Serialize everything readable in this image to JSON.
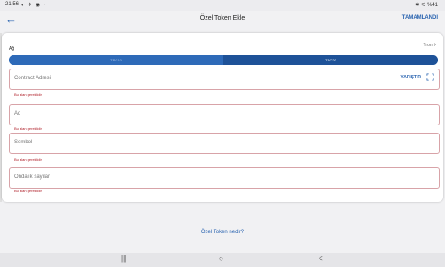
{
  "status": {
    "time": "21:56",
    "left_icons": "◐ ✈ ◉ ·",
    "right": "✱ ⚟ %41"
  },
  "header": {
    "title": "Özel Token Ekle",
    "done": "TAMAMLANDI"
  },
  "network": {
    "label": "Ağ",
    "value": "Tron",
    "tabs": [
      {
        "label": "TRC10"
      },
      {
        "label": "TRC20"
      }
    ]
  },
  "fields": [
    {
      "placeholder": "Contract Adresi",
      "paste": "YAPIŞTIR",
      "error": "Bu alan gereklidir"
    },
    {
      "placeholder": "Ad",
      "error": "Bu alan gereklidir"
    },
    {
      "placeholder": "Sembol",
      "error": "Bu alan gereklidir"
    },
    {
      "placeholder": "Ondalık sayılar",
      "error": "Bu alan gereklidir"
    }
  ],
  "link": "Özel Token nedir?",
  "colors": {
    "accent": "#2a64b0",
    "error": "#b0202a",
    "error_border": "#d8a3a8",
    "segment_active": "#1e5298"
  },
  "navbar": {
    "recent": "|||",
    "home": "○",
    "back": "<"
  }
}
